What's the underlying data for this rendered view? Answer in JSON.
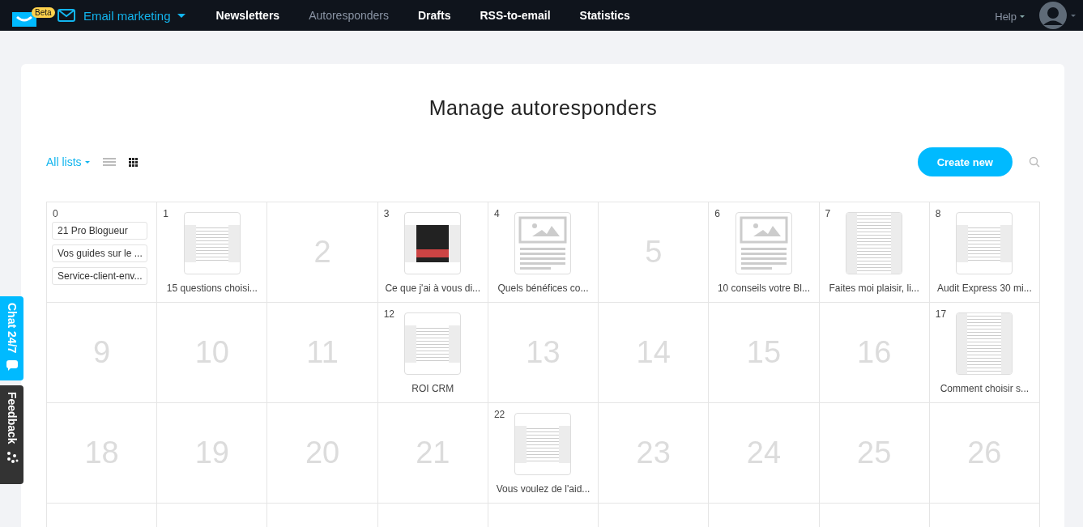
{
  "topbar": {
    "badge": "Beta",
    "product": "Email marketing",
    "nav": [
      {
        "label": "Newsletters",
        "selected": false
      },
      {
        "label": "Autoresponders",
        "selected": true
      },
      {
        "label": "Drafts",
        "selected": false
      },
      {
        "label": "RSS-to-email",
        "selected": false
      },
      {
        "label": "Statistics",
        "selected": false
      }
    ],
    "help": "Help"
  },
  "page": {
    "title": "Manage autoresponders",
    "list_filter": "All lists",
    "views": [
      {
        "kind": "list",
        "selected": false
      },
      {
        "kind": "grid",
        "selected": true
      }
    ],
    "create_button": "Create new"
  },
  "days": [
    {
      "day": "0",
      "kind": "lists",
      "lists": [
        "21 Pro Blogueur",
        "Vos guides sur le ...",
        "Service-client-env..."
      ]
    },
    {
      "day": "1",
      "kind": "message",
      "thumbnail": {
        "kind": "doc"
      },
      "title": "15 questions choisi..."
    },
    {
      "day": "2",
      "kind": "empty"
    },
    {
      "day": "3",
      "kind": "message",
      "thumbnail": {
        "kind": "dark"
      },
      "title": "Ce que j'ai à vous di..."
    },
    {
      "day": "4",
      "kind": "message",
      "thumbnail": {
        "kind": "placeholder"
      },
      "title": "Quels bénéfices co..."
    },
    {
      "day": "5",
      "kind": "empty"
    },
    {
      "day": "6",
      "kind": "message",
      "thumbnail": {
        "kind": "placeholder"
      },
      "title": "10 conseils votre Bl..."
    },
    {
      "day": "7",
      "kind": "message",
      "thumbnail": {
        "kind": "tall"
      },
      "title": "Faites moi plaisir, li..."
    },
    {
      "day": "8",
      "kind": "message",
      "thumbnail": {
        "kind": "doc"
      },
      "title": "Audit Express 30 mi..."
    },
    {
      "day": "9",
      "kind": "empty"
    },
    {
      "day": "10",
      "kind": "empty"
    },
    {
      "day": "11",
      "kind": "empty"
    },
    {
      "day": "12",
      "kind": "message",
      "thumbnail": {
        "kind": "doc"
      },
      "title": "ROI CRM"
    },
    {
      "day": "13",
      "kind": "empty"
    },
    {
      "day": "14",
      "kind": "empty"
    },
    {
      "day": "15",
      "kind": "empty"
    },
    {
      "day": "16",
      "kind": "empty"
    },
    {
      "day": "17",
      "kind": "message",
      "thumbnail": {
        "kind": "tall"
      },
      "title": "Comment choisir s..."
    },
    {
      "day": "18",
      "kind": "empty"
    },
    {
      "day": "19",
      "kind": "empty"
    },
    {
      "day": "20",
      "kind": "empty"
    },
    {
      "day": "21",
      "kind": "empty"
    },
    {
      "day": "22",
      "kind": "message",
      "thumbnail": {
        "kind": "doc"
      },
      "title": "Vous voulez de l'aid..."
    },
    {
      "day": "23",
      "kind": "empty"
    },
    {
      "day": "24",
      "kind": "empty"
    },
    {
      "day": "25",
      "kind": "empty"
    },
    {
      "day": "26",
      "kind": "empty"
    }
  ],
  "side_tabs": {
    "chat": "Chat 24/7",
    "feedback": "Feedback"
  }
}
